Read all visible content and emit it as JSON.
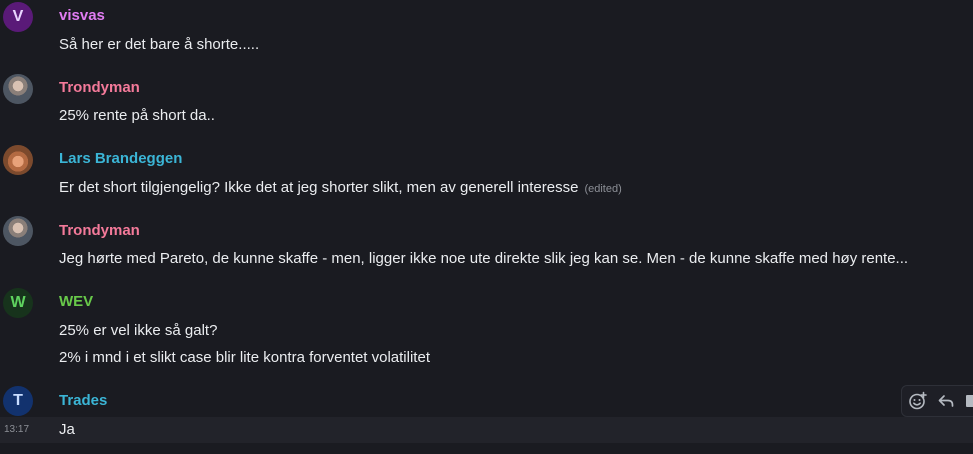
{
  "colors": {
    "background": "#1a1b21",
    "visvas": "#e07cf2",
    "trondyman": "#f47a9a",
    "lars": "#3bb5d6",
    "wev": "#68c94a",
    "trades": "#3bb5d6"
  },
  "messages": [
    {
      "author": "visvas",
      "avatar_letter": "V",
      "lines": [
        "Så her er det bare å shorte....."
      ]
    },
    {
      "author": "Trondyman",
      "avatar_icon": "user-photo-avatar",
      "lines": [
        "25% rente på short da.."
      ]
    },
    {
      "author": "Lars Brandeggen",
      "avatar_icon": "user-photo-avatar",
      "lines": [
        "Er det short tilgjengelig? Ikke det at jeg shorter slikt, men av generell interesse"
      ],
      "edited_label": "(edited)"
    },
    {
      "author": "Trondyman",
      "avatar_icon": "user-photo-avatar",
      "lines": [
        "Jeg hørte med Pareto, de kunne skaffe - men, ligger ikke noe ute direkte slik jeg kan se. Men - de kunne skaffe med høy rente..."
      ]
    },
    {
      "author": "WEV",
      "avatar_letter": "W",
      "lines": [
        "25% er vel ikke så galt?",
        "2% i mnd i et slikt case blir lite kontra forventet volatilitet"
      ]
    },
    {
      "author": "Trades",
      "avatar_letter": "T",
      "lines": []
    }
  ],
  "hovered_message": {
    "timestamp": "13:17",
    "text": "Ja"
  },
  "toolbar": {
    "icons": [
      "add-reaction-icon",
      "reply-icon",
      "more-icon"
    ]
  }
}
